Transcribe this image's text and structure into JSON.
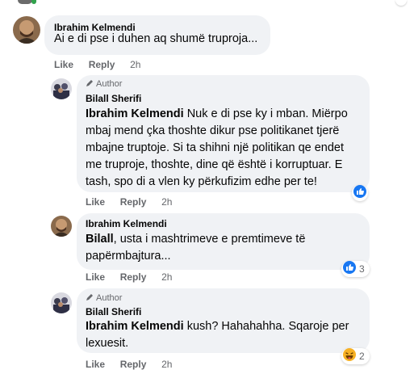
{
  "colors": {
    "bubble_bg": "#f0f2f5",
    "meta_text": "#65676b",
    "like_blue": "#1877f2",
    "haha_yellow": "#f7b125"
  },
  "comments": [
    {
      "author": "Ibrahim Kelmendi",
      "badge": "",
      "text_lines": [
        "Ai e di pse i duhen aq shumë truproja..."
      ],
      "actions": {
        "like": "Like",
        "reply": "Reply",
        "time": "2h"
      },
      "reaction": {
        "icon": "",
        "count": ""
      }
    },
    {
      "author": "Bilall Sherifi",
      "badge": "Author",
      "mention": "Ibrahim Kelmendi",
      "text_lines": [
        " Nuk e di pse ky i mban. Miërpo",
        "mbaj mend çka thoshte dikur pse politikanet tjerë",
        "mbajne truptoje. Si ta shihni një politikan qe endet",
        "me truproje, thoshte, dine që është i korruptuar. E",
        "tash, spo di a vlen ky përkufizim edhe per te!"
      ],
      "actions": {
        "like": "Like",
        "reply": "Reply",
        "time": "2h"
      },
      "reaction": {
        "icon": "like-icon",
        "count": ""
      }
    },
    {
      "author": "Ibrahim Kelmendi",
      "badge": "",
      "mention": "Bilall",
      "text_lines": [
        ", usta i mashtrimeve e premtimeve të",
        "papërmbajtura..."
      ],
      "actions": {
        "like": "Like",
        "reply": "Reply",
        "time": "2h"
      },
      "reaction": {
        "icon": "like-icon",
        "count": "3"
      }
    },
    {
      "author": "Bilall Sherifi",
      "badge": "Author",
      "mention": "Ibrahim Kelmendi",
      "text_lines": [
        " kush? Hahahahha. Sqaroje per",
        "lexuesit."
      ],
      "actions": {
        "like": "Like",
        "reply": "Reply",
        "time": "2h"
      },
      "reaction": {
        "icon": "haha-icon",
        "count": "2"
      }
    }
  ]
}
